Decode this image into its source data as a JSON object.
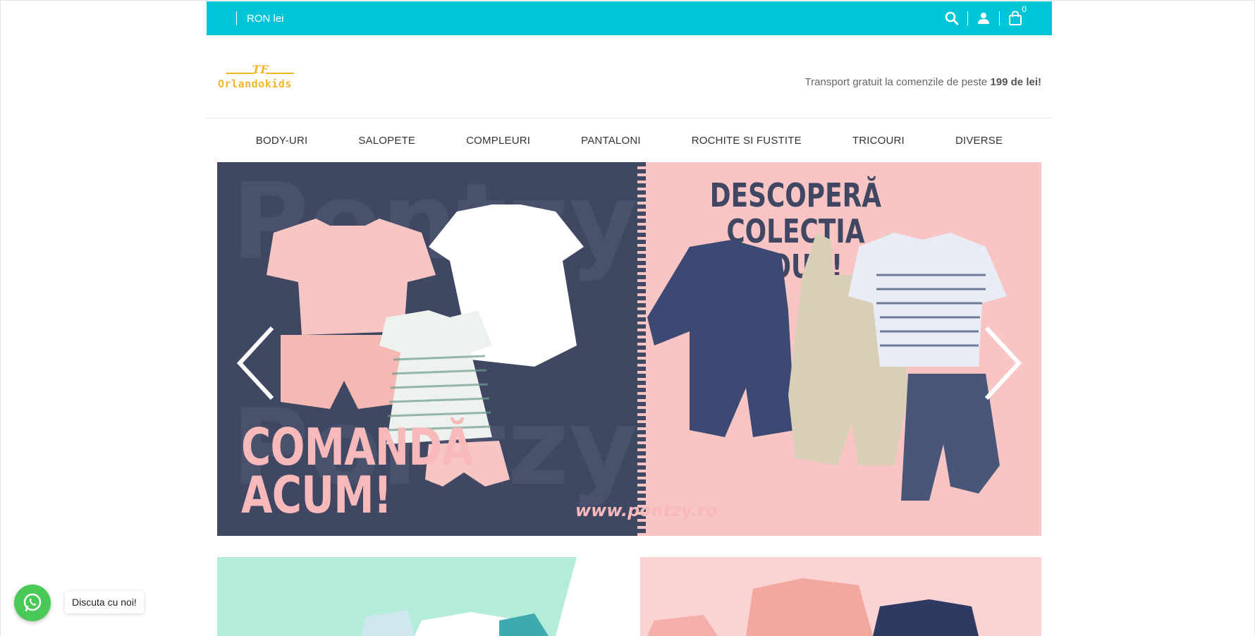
{
  "topbar": {
    "currency": "RON lei",
    "cart_count": "0",
    "icons": [
      "search-icon",
      "user-icon",
      "cart-icon"
    ]
  },
  "header": {
    "logo_text": "Orlandokids",
    "promo_text": "Transport gratuit la comenzile de peste ",
    "promo_bold": "199 de lei!"
  },
  "nav": {
    "items": [
      {
        "label": "BODY-URI"
      },
      {
        "label": "SALOPETE"
      },
      {
        "label": "COMPLEURI"
      },
      {
        "label": "PANTALONI"
      },
      {
        "label": "ROCHITE SI FUSTITE"
      },
      {
        "label": "TRICOURI"
      },
      {
        "label": "DIVERSE"
      }
    ]
  },
  "hero": {
    "headline_left_1": "COMANDĂ",
    "headline_left_2": "ACUM!",
    "headline_right_1": "DESCOPERĂ",
    "headline_right_2": "COLECȚIA NOUĂ!",
    "url": "www.pontzy.ro",
    "watermark": "Pontzy",
    "icons": [
      "chevron-left-icon",
      "chevron-right-icon"
    ]
  },
  "chat": {
    "label": "Discuta cu noi!",
    "icon": "whatsapp-icon"
  },
  "colors": {
    "topbar": "#00c5d6",
    "hero_navy": "#3f4763",
    "hero_pink": "#f9c4c4",
    "logo": "#f3b52a",
    "whatsapp": "#4ac959"
  }
}
